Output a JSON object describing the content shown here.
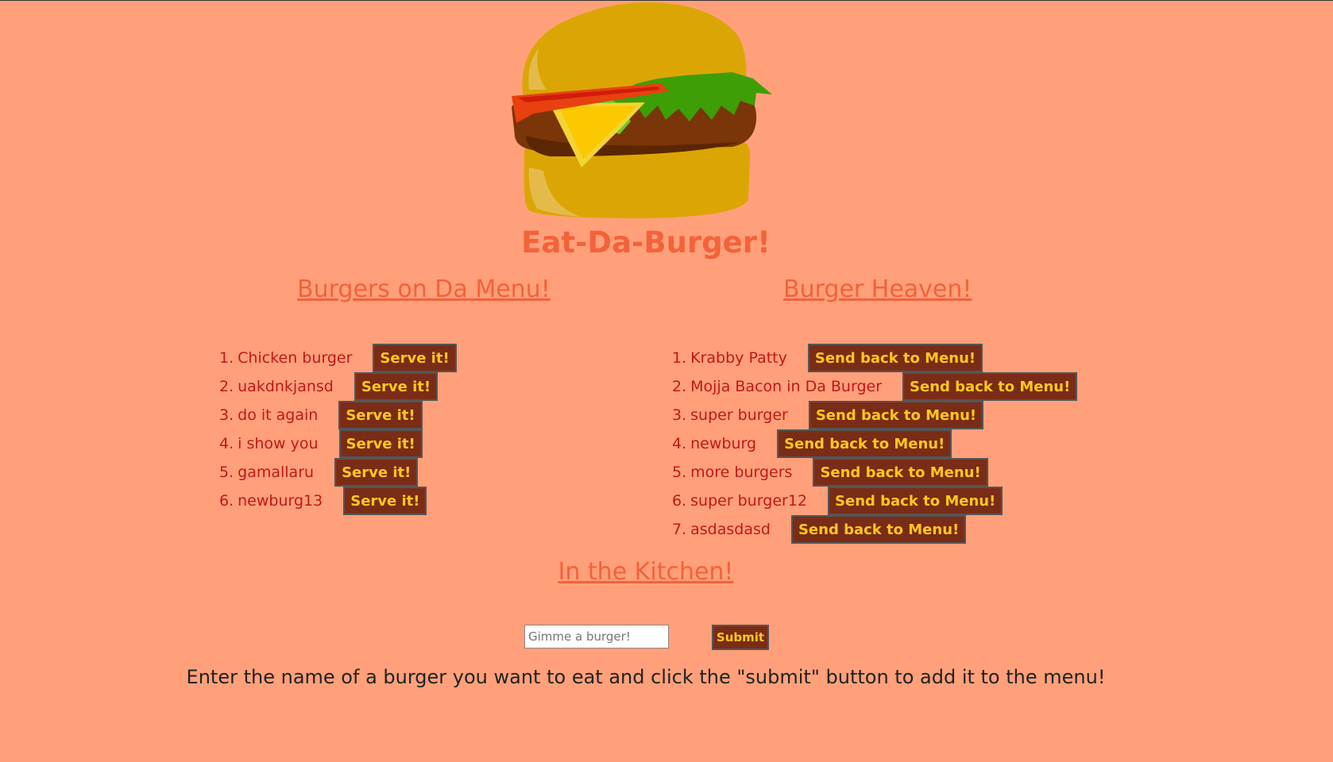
{
  "header": {
    "title": "Eat-Da-Burger!"
  },
  "menu": {
    "heading": "Burgers on Da Menu!",
    "button_label": "Serve it!",
    "items": [
      {
        "num": "1.",
        "name": "Chicken burger"
      },
      {
        "num": "2.",
        "name": "uakdnkjansd"
      },
      {
        "num": "3.",
        "name": "do it again"
      },
      {
        "num": "4.",
        "name": "i show you"
      },
      {
        "num": "5.",
        "name": "gamallaru"
      },
      {
        "num": "6.",
        "name": "newburg13"
      }
    ]
  },
  "heaven": {
    "heading": "Burger Heaven!",
    "button_label": "Send back to Menu!",
    "items": [
      {
        "num": "1.",
        "name": "Krabby Patty"
      },
      {
        "num": "2.",
        "name": "Mojja Bacon in Da Burger"
      },
      {
        "num": "3.",
        "name": "super burger"
      },
      {
        "num": "4.",
        "name": "newburg"
      },
      {
        "num": "5.",
        "name": "more burgers"
      },
      {
        "num": "6.",
        "name": "super burger12"
      },
      {
        "num": "7.",
        "name": "asdasdasd"
      }
    ]
  },
  "kitchen": {
    "heading": "In the Kitchen!",
    "input_placeholder": "Gimme a burger!",
    "input_value": "",
    "submit_label": "Submit",
    "instructions": "Enter the name of a burger you want to eat and click the \"submit\" button to add it to the menu!"
  },
  "colors": {
    "background": "#ffa07a",
    "heading": "#f4623a",
    "item_text": "#c0181a",
    "button_bg": "#7b2c16",
    "button_text": "#ffc71f"
  },
  "icons": {
    "logo": "burger-logo-icon"
  }
}
